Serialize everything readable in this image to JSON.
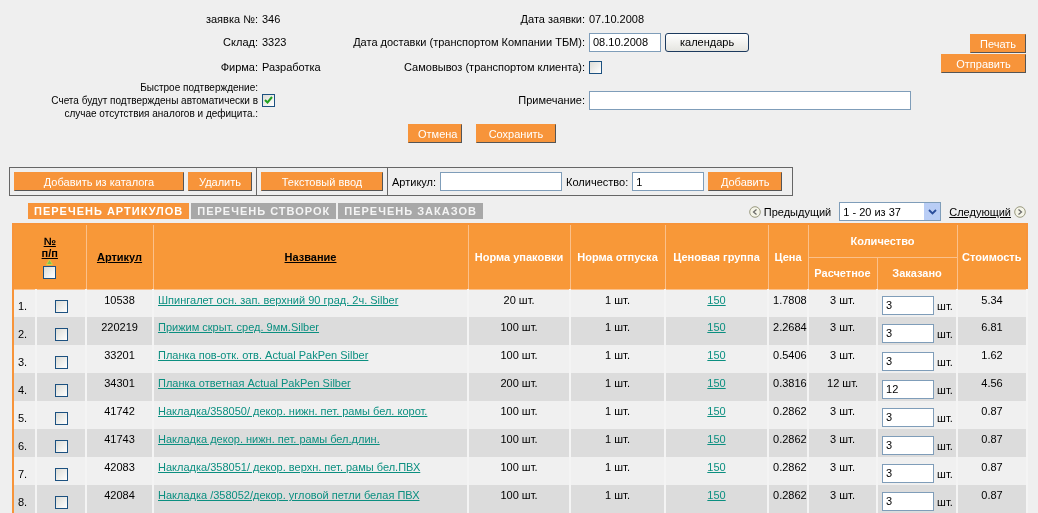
{
  "order": {
    "number_label": "заявка №:",
    "number": "346",
    "warehouse_label": "Склад:",
    "warehouse": "3323",
    "firm_label": "Фирма:",
    "firm": "Разработка",
    "quick_confirm_label": "Быстрое подтверждение:\nСчета будут подтверждены автоматически в\nслучае отсутствия аналогов и дефицита.:",
    "quick_confirm_checked": true,
    "date_label": "Дата заявки:",
    "date": "07.10.2008",
    "delivery_label": "Дата доставки (транспортом Компании ТБМ):",
    "delivery_date": "08.10.2008",
    "calendar_button": "календарь",
    "pickup_label": "Самовывоз (транспортом клиента):",
    "pickup_checked": false,
    "note_label": "Примечание:"
  },
  "side_buttons": [
    "Печать",
    "Отправить"
  ],
  "form_buttons": [
    "Отмена",
    "Сохранить"
  ],
  "toolbar": {
    "buttons": [
      "Добавить из каталога",
      "Удалить",
      "Текстовый ввод"
    ],
    "article_label": "Артикул:",
    "quantity_label": "Количество:",
    "quantity": "1",
    "add_button": "Добавить"
  },
  "tabs": [
    {
      "label": "ПЕРЕЧЕНЬ АРТИКУЛОВ",
      "selected": true
    },
    {
      "label": "ПЕРЕЧЕНЬ СТВОРОК",
      "selected": false
    },
    {
      "label": "ПЕРЕЧЕНЬ ЗАКАЗОВ",
      "selected": false
    }
  ],
  "pagination": {
    "prev": "Предыдущий",
    "range": "1 - 20 из 37",
    "next": "Следующий"
  },
  "table": {
    "columns": {
      "number": "№\nп/п",
      "article": "Артикул",
      "name": "Название",
      "pack": "Норма упаковки",
      "release": "Норма отпуска",
      "price_group": "Ценовая группа",
      "price": "Цена",
      "quantity": "Количество",
      "calculated": "Расчетное",
      "ordered": "Заказано",
      "cost": "Стоимость"
    },
    "select_all_checked": false,
    "rows": [
      {
        "number": "1.",
        "checked": false,
        "article": "10538",
        "name": "Шпингалет осн. зап. верхний 90 град. 2ч. Silber",
        "pack": "20 шт.",
        "release": "1 шт.",
        "price_group": "150",
        "price": "1.7808",
        "calculated": "3 шт.",
        "ordered": "3",
        "unit": "шт.",
        "cost": "5.34"
      },
      {
        "number": "2.",
        "checked": false,
        "article": "220219",
        "name": "Прижим скрыт. сред. 9мм.Silber",
        "pack": "100 шт.",
        "release": "1 шт.",
        "price_group": "150",
        "price": "2.2684",
        "calculated": "3 шт.",
        "ordered": "3",
        "unit": "шт.",
        "cost": "6.81"
      },
      {
        "number": "3.",
        "checked": false,
        "article": "33201",
        "name": "Планка пов-отк. отв. Actual PakPen Silber",
        "pack": "100 шт.",
        "release": "1 шт.",
        "price_group": "150",
        "price": "0.5406",
        "calculated": "3 шт.",
        "ordered": "3",
        "unit": "шт.",
        "cost": "1.62"
      },
      {
        "number": "4.",
        "checked": false,
        "article": "34301",
        "name": "Планка ответная Actual PakPen Silber",
        "pack": "200 шт.",
        "release": "1 шт.",
        "price_group": "150",
        "price": "0.3816",
        "calculated": "12 шт.",
        "ordered": "12",
        "unit": "шт.",
        "cost": "4.56"
      },
      {
        "number": "5.",
        "checked": false,
        "article": "41742",
        "name": "Накладка/358050/ декор. нижн. пет. рамы бел. корот.",
        "pack": "100 шт.",
        "release": "1 шт.",
        "price_group": "150",
        "price": "0.2862",
        "calculated": "3 шт.",
        "ordered": "3",
        "unit": "шт.",
        "cost": "0.87"
      },
      {
        "number": "6.",
        "checked": false,
        "article": "41743",
        "name": "Накладка декор. нижн. пет. рамы бел.длин.",
        "pack": "100 шт.",
        "release": "1 шт.",
        "price_group": "150",
        "price": "0.2862",
        "calculated": "3 шт.",
        "ordered": "3",
        "unit": "шт.",
        "cost": "0.87"
      },
      {
        "number": "7.",
        "checked": false,
        "article": "42083",
        "name": "Накладка/358051/ декор. верхн. пет. рамы бел.ПВХ",
        "pack": "100 шт.",
        "release": "1 шт.",
        "price_group": "150",
        "price": "0.2862",
        "calculated": "3 шт.",
        "ordered": "3",
        "unit": "шт.",
        "cost": "0.87"
      },
      {
        "number": "8.",
        "checked": false,
        "article": "42084",
        "name": "Накладка /358052/декор. угловой петли белая ПВХ",
        "pack": "100 шт.",
        "release": "1 шт.",
        "price_group": "150",
        "price": "0.2862",
        "calculated": "3 шт.",
        "ordered": "3",
        "unit": "шт.",
        "cost": "0.87"
      }
    ]
  }
}
